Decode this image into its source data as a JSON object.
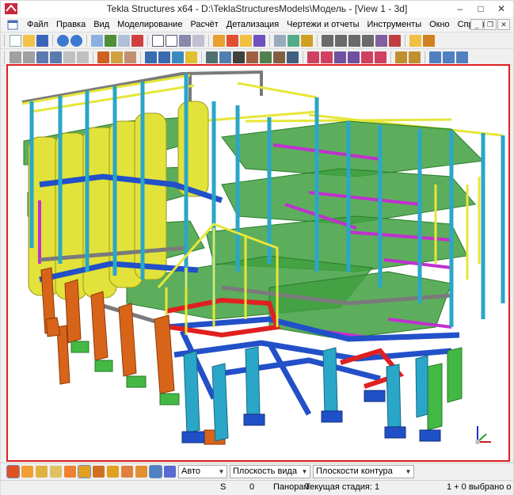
{
  "window": {
    "title": "Tekla Structures x64 - D:\\TeklaStructuresModels\\Модель  - [View 1 - 3d]"
  },
  "menu": [
    "Файл",
    "Правка",
    "Вид",
    "Моделирование",
    "Расчёт",
    "Детализация",
    "Чертежи и отчеты",
    "Инструменты",
    "Окно",
    "Справка"
  ],
  "bottom": {
    "combo_auto": "Авто",
    "combo_view_plane": "Плоскость вида",
    "combo_contour": "Плоскости контура"
  },
  "status": {
    "s": "S",
    "zero": "0",
    "mode": "Панорам",
    "stage": "Текущая стадия: 1",
    "selected": "1 + 0 выбрано о"
  },
  "colors": {
    "viewport_border": "#e02020",
    "column_cyan": "#2aa6c8",
    "orange": "#d8641a",
    "yellow": "#e6e63a",
    "green": "#3fae3f",
    "blue": "#2250c8",
    "magenta": "#c030d0",
    "red": "#e02020",
    "gray": "#7a7a7a"
  }
}
